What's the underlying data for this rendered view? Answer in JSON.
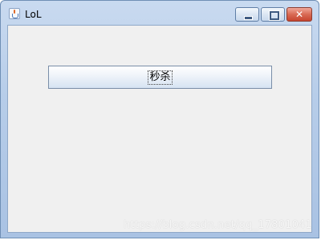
{
  "window": {
    "title": "LoL",
    "icon": "java-coffee-icon"
  },
  "titlebar_buttons": {
    "minimize_icon": "minimize-icon",
    "maximize_icon": "maximize-icon",
    "close_icon": "close-icon",
    "close_glyph": "✕"
  },
  "main": {
    "button_label": "秒杀"
  },
  "watermark": "https://blog.csdn.net/qq_17801041",
  "colors": {
    "client_background": "#f0f0f0",
    "titlebar": "#b7cde9",
    "close_button": "#c7452f"
  }
}
